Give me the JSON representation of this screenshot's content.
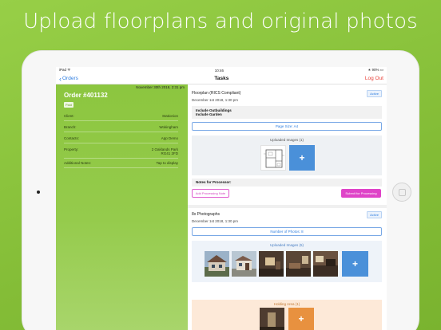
{
  "headline": "Upload floorplans and original photos",
  "statusbar": {
    "left": "iPad ᯤ",
    "time": "10:46",
    "right": "∗ 90% ▭"
  },
  "navbar": {
    "back_label": "Orders",
    "title": "Tasks",
    "logout_label": "Log Out"
  },
  "order": {
    "date": "November 30th 2018, 2:31 pm",
    "number": "Order #401132",
    "paid_badge": "Paid",
    "rows": [
      {
        "label": "Client:",
        "value": "Stationion"
      },
      {
        "label": "Branch:",
        "value": "Wokingham"
      },
      {
        "label": "Contacts:",
        "value": "App Demo"
      },
      {
        "label": "Property:",
        "value": "2 Oaklands Park",
        "value2": "RG41 2FD"
      },
      {
        "label": "Additional Notes:",
        "value": "Tap to display"
      }
    ]
  },
  "floorplan_task": {
    "title": "Floorplan (RICS Compliant)",
    "badge": "Active",
    "date": "December 1st 2018, 1:30 pm",
    "include_lines": [
      "Include Outbuildings",
      "Include Garden"
    ],
    "page_size_button": "Page Size: A4",
    "uploaded_label": "Uploaded Images (1)",
    "plus": "+",
    "notes_label": "Notes for Processor:",
    "add_note_button": "Add Processing Note",
    "submit_button": "Submit for Processing"
  },
  "photos_task": {
    "title": "8x Photographs",
    "badge": "Active",
    "date": "December 1st 2018, 1:30 pm",
    "number_button": "Number of Photos: 8",
    "uploaded_label": "Uploaded Images (5)",
    "plus": "+",
    "holding_label": "Holding Area (1)",
    "holding_plus": "+"
  },
  "colors": {
    "background": "#8cc63f",
    "link_blue": "#2d7de0",
    "upload_blue": "#4a90d9",
    "logout_red": "#e8433b",
    "submit_magenta": "#df44c8",
    "holding_orange": "#e8913f"
  }
}
